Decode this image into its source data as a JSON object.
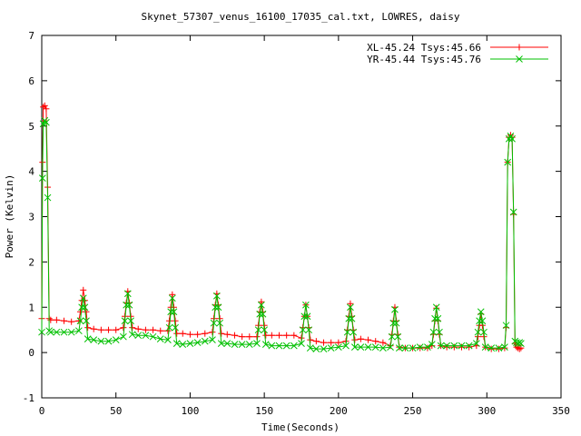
{
  "chart_data": {
    "type": "line",
    "title": "Skynet_57307_venus_16100_17035_cal.txt, LOWRES, daisy",
    "xlabel": "Time(Seconds)",
    "ylabel": "Power (Kelvin)",
    "xlim": [
      0,
      350
    ],
    "ylim": [
      -1,
      7
    ],
    "xticks": [
      "0",
      "50",
      "100",
      "150",
      "200",
      "250",
      "300",
      "350"
    ],
    "yticks": [
      "-1",
      "0",
      "1",
      "2",
      "3",
      "4",
      "5",
      "6",
      "7"
    ],
    "grid": false,
    "legend_position": "top-right",
    "series": [
      {
        "name": "XL-45.24 Tsys:45.66",
        "color": "#ff0000",
        "marker": "plus",
        "x": [
          0,
          0.5,
          1,
          2,
          3,
          4,
          5,
          6,
          10,
          15,
          20,
          25,
          26,
          27,
          28,
          29,
          30,
          31,
          35,
          40,
          45,
          50,
          55,
          56,
          57,
          58,
          59,
          60,
          61,
          65,
          70,
          75,
          80,
          85,
          86,
          87,
          88,
          89,
          90,
          91,
          95,
          100,
          105,
          110,
          115,
          116,
          117,
          118,
          119,
          120,
          121,
          125,
          130,
          135,
          140,
          145,
          146,
          147,
          148,
          149,
          150,
          151,
          155,
          160,
          165,
          170,
          175,
          176,
          177,
          178,
          179,
          180,
          181,
          185,
          190,
          195,
          200,
          205,
          206,
          207,
          208,
          209,
          210,
          211,
          215,
          220,
          225,
          230,
          235,
          236,
          237,
          238,
          239,
          240,
          241,
          245,
          250,
          255,
          260,
          263,
          264,
          265,
          266,
          267,
          268,
          269,
          273,
          278,
          283,
          288,
          293,
          294,
          295,
          296,
          297,
          298,
          299,
          303,
          308,
          312,
          313,
          314,
          315,
          316,
          317,
          318,
          319,
          320,
          321,
          322,
          323
        ],
        "y": [
          0.75,
          4.2,
          5.42,
          5.45,
          5.38,
          3.65,
          0.75,
          0.72,
          0.72,
          0.7,
          0.68,
          0.7,
          0.9,
          1.15,
          1.38,
          1.15,
          0.9,
          0.55,
          0.52,
          0.5,
          0.5,
          0.5,
          0.55,
          0.8,
          1.1,
          1.35,
          1.1,
          0.8,
          0.55,
          0.52,
          0.5,
          0.5,
          0.48,
          0.48,
          0.7,
          1.0,
          1.28,
          1.0,
          0.7,
          0.42,
          0.42,
          0.4,
          0.4,
          0.42,
          0.45,
          0.75,
          1.05,
          1.3,
          1.05,
          0.75,
          0.42,
          0.4,
          0.38,
          0.35,
          0.35,
          0.35,
          0.6,
          0.9,
          1.12,
          0.9,
          0.6,
          0.38,
          0.38,
          0.38,
          0.38,
          0.38,
          0.32,
          0.55,
          0.8,
          1.05,
          0.8,
          0.55,
          0.28,
          0.25,
          0.22,
          0.22,
          0.22,
          0.25,
          0.5,
          0.8,
          1.08,
          0.8,
          0.5,
          0.28,
          0.3,
          0.28,
          0.25,
          0.22,
          0.15,
          0.4,
          0.7,
          1.0,
          0.7,
          0.4,
          0.12,
          0.1,
          0.1,
          0.1,
          0.1,
          0.15,
          0.4,
          0.7,
          0.98,
          0.7,
          0.4,
          0.15,
          0.12,
          0.12,
          0.12,
          0.12,
          0.15,
          0.35,
          0.6,
          0.85,
          0.6,
          0.35,
          0.12,
          0.08,
          0.08,
          0.1,
          0.55,
          4.2,
          4.75,
          4.8,
          4.75,
          3.05,
          0.2,
          0.12,
          0.1,
          0.08,
          0.1
        ]
      },
      {
        "name": "YR-45.44 Tsys:45.76",
        "color": "#00c000",
        "marker": "cross",
        "x": [
          0,
          0.5,
          1,
          2,
          3,
          4,
          5,
          6,
          10,
          15,
          20,
          25,
          26,
          27,
          28,
          29,
          30,
          31,
          35,
          40,
          45,
          50,
          55,
          56,
          57,
          58,
          59,
          60,
          61,
          65,
          70,
          75,
          80,
          85,
          86,
          87,
          88,
          89,
          90,
          91,
          95,
          100,
          105,
          110,
          115,
          116,
          117,
          118,
          119,
          120,
          121,
          125,
          130,
          135,
          140,
          145,
          146,
          147,
          148,
          149,
          150,
          151,
          155,
          160,
          165,
          170,
          175,
          176,
          177,
          178,
          179,
          180,
          181,
          185,
          190,
          195,
          200,
          205,
          206,
          207,
          208,
          209,
          210,
          211,
          215,
          220,
          225,
          230,
          235,
          236,
          237,
          238,
          239,
          240,
          241,
          245,
          250,
          255,
          260,
          263,
          264,
          265,
          266,
          267,
          268,
          269,
          273,
          278,
          283,
          288,
          293,
          294,
          295,
          296,
          297,
          298,
          299,
          303,
          308,
          312,
          313,
          314,
          315,
          316,
          317,
          318,
          319,
          320,
          321,
          322,
          323
        ],
        "y": [
          0.45,
          3.85,
          5.05,
          5.12,
          5.08,
          3.42,
          0.48,
          0.45,
          0.45,
          0.45,
          0.45,
          0.48,
          0.7,
          1.0,
          1.2,
          1.0,
          0.7,
          0.3,
          0.28,
          0.25,
          0.25,
          0.28,
          0.35,
          0.7,
          1.05,
          1.3,
          1.05,
          0.7,
          0.4,
          0.38,
          0.38,
          0.35,
          0.3,
          0.28,
          0.55,
          0.9,
          1.2,
          0.9,
          0.55,
          0.2,
          0.18,
          0.2,
          0.22,
          0.25,
          0.28,
          0.65,
          1.0,
          1.25,
          1.0,
          0.65,
          0.2,
          0.2,
          0.18,
          0.18,
          0.18,
          0.2,
          0.5,
          0.85,
          1.05,
          0.85,
          0.5,
          0.18,
          0.15,
          0.15,
          0.15,
          0.15,
          0.2,
          0.5,
          0.8,
          1.05,
          0.8,
          0.5,
          0.1,
          0.08,
          0.08,
          0.1,
          0.12,
          0.15,
          0.45,
          0.75,
          1.0,
          0.75,
          0.45,
          0.12,
          0.12,
          0.12,
          0.12,
          0.1,
          0.12,
          0.35,
          0.65,
          0.95,
          0.65,
          0.35,
          0.1,
          0.1,
          0.1,
          0.12,
          0.12,
          0.18,
          0.45,
          0.75,
          1.0,
          0.75,
          0.45,
          0.15,
          0.15,
          0.15,
          0.15,
          0.15,
          0.2,
          0.45,
          0.7,
          0.9,
          0.7,
          0.45,
          0.12,
          0.1,
          0.1,
          0.12,
          0.6,
          4.2,
          4.72,
          4.78,
          4.72,
          3.1,
          0.25,
          0.22,
          0.2,
          0.22,
          0.2
        ]
      }
    ]
  }
}
